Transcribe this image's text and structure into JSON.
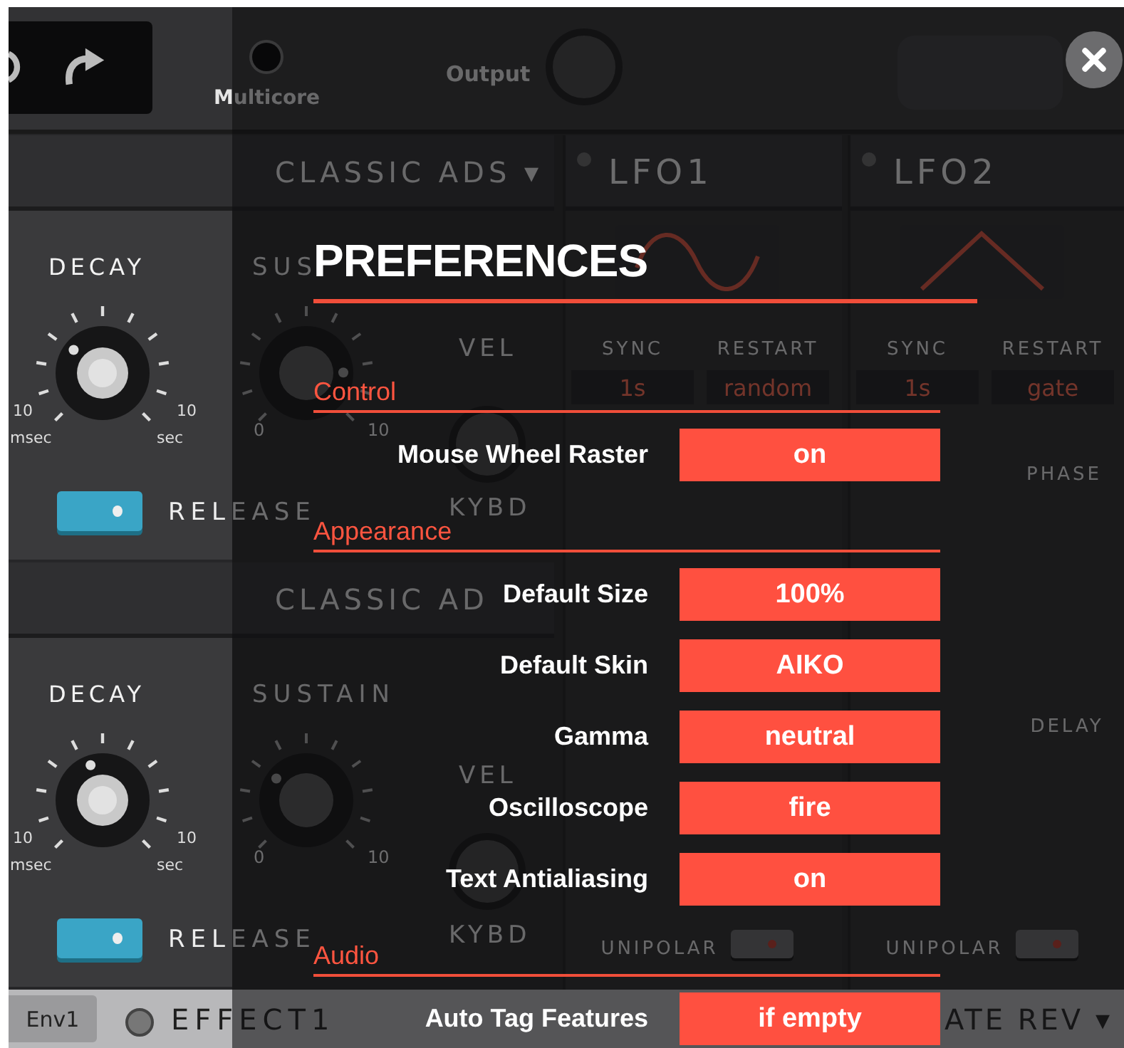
{
  "toolbar": {
    "multicore_label": "Multicore",
    "output_label": "Output"
  },
  "envelopes": [
    {
      "mode_label": "CLASSIC ADS ▾",
      "decay_label": "DECAY",
      "decay_knob": {
        "level": 0.31
      },
      "min_value": "10",
      "min_unit": "msec",
      "max_value": "10",
      "max_unit": "sec",
      "release_switch": {
        "label": "RELEASE",
        "on": true
      },
      "sustain_label": "SUS",
      "sustain_knob": {
        "level": 0.83
      },
      "sustain_min": "0",
      "sustain_max": "10",
      "vel_label": "VEL",
      "kybd_label": "KYBD"
    },
    {
      "mode_label": "CLASSIC AD",
      "decay_label": "DECAY",
      "decay_knob": {
        "level": 0.43
      },
      "min_value": "10",
      "min_unit": "msec",
      "max_value": "10",
      "max_unit": "sec",
      "release_switch": {
        "label": "RELEASE",
        "on": true
      },
      "sustain_label": "SUSTAIN",
      "sustain_knob": {
        "level": 0.3
      },
      "sustain_min": "0",
      "sustain_max": "10",
      "vel_label": "VEL",
      "kybd_label": "KYBD"
    }
  ],
  "lfos": [
    {
      "name": "LFO1",
      "kind": "sine",
      "sync_label": "SYNC",
      "sync_value": "1s",
      "restart_label": "RESTART",
      "restart_value": "random",
      "unipolar": {
        "label": "UNIPOLAR",
        "on": false
      }
    },
    {
      "name": "LFO2",
      "kind": "triangle",
      "sync_label": "SYNC",
      "sync_value": "1s",
      "restart_label": "RESTART",
      "restart_value": "gate",
      "phase_label": "PHASE",
      "delay_label": "DELAY",
      "unipolar": {
        "label": "UNIPOLAR",
        "on": false
      }
    }
  ],
  "bottom_bar": {
    "tab": "Env1",
    "effect": {
      "label": "EFFECT1",
      "selected": false
    },
    "effect_mode": "ATE REV ▾"
  },
  "dialog": {
    "title": "PREFERENCES",
    "sections": [
      {
        "heading": "Control",
        "rows": [
          {
            "label": "Mouse Wheel Raster",
            "value": "on"
          }
        ]
      },
      {
        "heading": "Appearance",
        "rows": [
          {
            "label": "Default Size",
            "value": "100%"
          },
          {
            "label": "Default Skin",
            "value": "AIKO"
          },
          {
            "label": "Gamma",
            "value": "neutral"
          },
          {
            "label": "Oscilloscope",
            "value": "fire"
          },
          {
            "label": "Text Antialiasing",
            "value": "on"
          }
        ]
      },
      {
        "heading": "Audio",
        "rows": [
          {
            "label": "Auto Tag Features",
            "value": "if empty"
          }
        ]
      }
    ]
  }
}
